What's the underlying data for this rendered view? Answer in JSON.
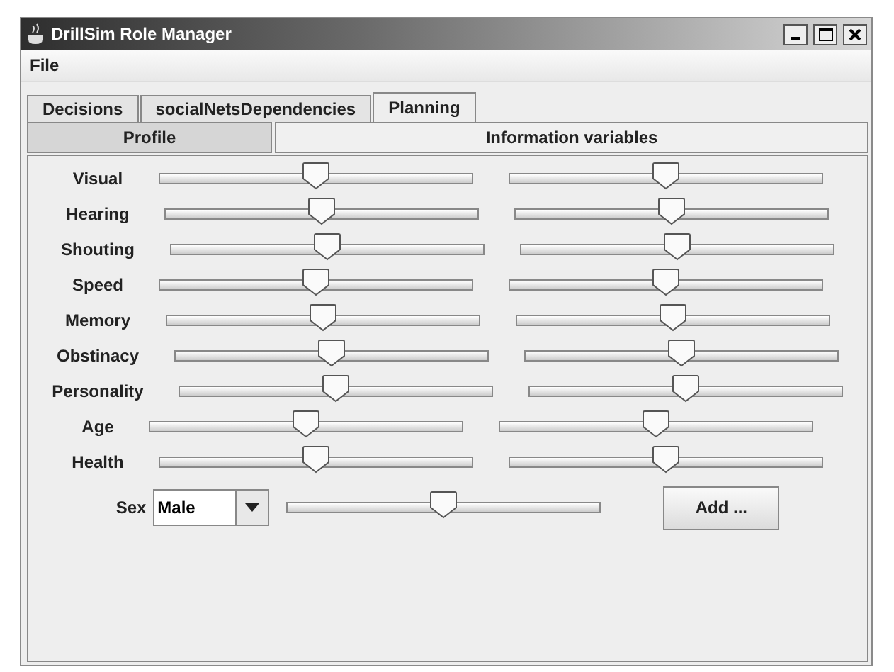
{
  "window": {
    "title": "DrillSim Role Manager"
  },
  "menu": [
    "File"
  ],
  "tabs": [
    {
      "label": "Decisions",
      "selected": false
    },
    {
      "label": "socialNetsDependencies",
      "selected": false
    },
    {
      "label": "Planning",
      "selected": true
    }
  ],
  "subtabs": [
    {
      "label": "Profile",
      "selected": true
    },
    {
      "label": "Information variables",
      "selected": false
    }
  ],
  "rows": [
    {
      "label": "Visual",
      "sliders": [
        {
          "level": 0.5
        },
        {
          "level": 0.5
        }
      ]
    },
    {
      "label": "Hearing",
      "sliders": [
        {
          "level": 0.5
        },
        {
          "level": 0.5
        }
      ]
    },
    {
      "label": "Shouting",
      "sliders": [
        {
          "level": 0.5
        },
        {
          "level": 0.5
        }
      ]
    },
    {
      "label": "Speed",
      "sliders": [
        {
          "level": 0.5
        },
        {
          "level": 0.5
        }
      ]
    },
    {
      "label": "Memory",
      "sliders": [
        {
          "level": 0.5
        },
        {
          "level": 0.5
        }
      ]
    },
    {
      "label": "Obstinacy",
      "sliders": [
        {
          "level": 0.5
        },
        {
          "level": 0.5
        }
      ]
    },
    {
      "label": "Personality",
      "sliders": [
        {
          "level": 0.5
        },
        {
          "level": 0.5
        }
      ]
    },
    {
      "label": "Age",
      "sliders": [
        {
          "level": 0.5
        },
        {
          "level": 0.5
        }
      ]
    },
    {
      "label": "Health",
      "sliders": [
        {
          "level": 0.5
        },
        {
          "level": 0.5
        }
      ]
    }
  ],
  "sex": {
    "label": "Sex",
    "value": "Male",
    "slider": {
      "level": 0.5
    }
  },
  "buttons": [
    "Add ..."
  ]
}
